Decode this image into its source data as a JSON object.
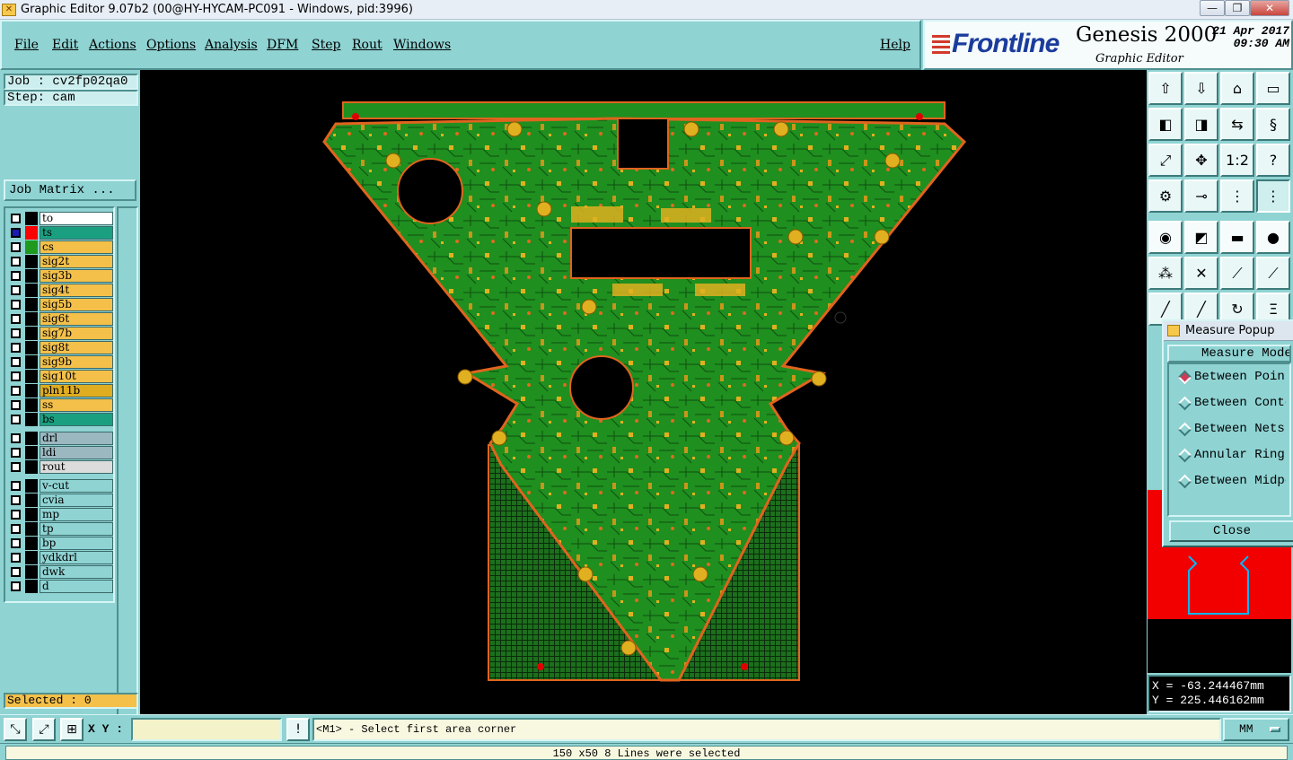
{
  "window": {
    "title": "Graphic Editor 9.07b2 (00@HY-HYCAM-PC091 - Windows, pid:3996)",
    "minimize_glyph": "—",
    "maximize_glyph": "❐",
    "close_glyph": "✕"
  },
  "menu": {
    "file": "File",
    "edit": "Edit",
    "actions": "Actions",
    "options": "Options",
    "analysis": "Analysis",
    "dfm": "DFM",
    "step": "Step",
    "rout": "Rout",
    "windows": "Windows",
    "help": "Help"
  },
  "brand": {
    "logo": "Frontline",
    "product": "Genesis 2000",
    "subtitle": "Graphic Editor",
    "date": "21 Apr 2017",
    "time": "09:30 AM"
  },
  "left": {
    "job": "Job : cv2fp02qa0",
    "step": "Step: cam",
    "job_matrix": "Job Matrix ...",
    "selected": "Selected : 0"
  },
  "layers": [
    {
      "name": "to",
      "color": "#ffffff",
      "swatch": "#000000",
      "checked": false
    },
    {
      "name": "ts",
      "color": "#1aa080",
      "swatch": "#ff0000",
      "checked": true
    },
    {
      "name": "cs",
      "color": "#f4c04a",
      "swatch": "#1f9a1f",
      "checked": false
    },
    {
      "name": "sig2t",
      "color": "#f4c04a",
      "swatch": "#000000",
      "checked": false
    },
    {
      "name": "sig3b",
      "color": "#f4c04a",
      "swatch": "#000000",
      "checked": false
    },
    {
      "name": "sig4t",
      "color": "#f4c04a",
      "swatch": "#000000",
      "checked": false
    },
    {
      "name": "sig5b",
      "color": "#f4c04a",
      "swatch": "#000000",
      "checked": false
    },
    {
      "name": "sig6t",
      "color": "#f4c04a",
      "swatch": "#000000",
      "checked": false
    },
    {
      "name": "sig7b",
      "color": "#f4c04a",
      "swatch": "#000000",
      "checked": false
    },
    {
      "name": "sig8t",
      "color": "#f4c04a",
      "swatch": "#000000",
      "checked": false
    },
    {
      "name": "sig9b",
      "color": "#f4c04a",
      "swatch": "#000000",
      "checked": false
    },
    {
      "name": "sig10t",
      "color": "#f4c04a",
      "swatch": "#000000",
      "checked": false
    },
    {
      "name": "pln11b",
      "color": "#e0ac20",
      "swatch": "#000000",
      "checked": false
    },
    {
      "name": "ss",
      "color": "#f4c04a",
      "swatch": "#000000",
      "checked": false
    },
    {
      "name": "bs",
      "color": "#1aa080",
      "swatch": "#000000",
      "checked": false
    },
    {
      "name": "drl",
      "color": "#9bb8c0",
      "swatch": "#000000",
      "checked": false
    },
    {
      "name": "ldi",
      "color": "#9bb8c0",
      "swatch": "#000000",
      "checked": false
    },
    {
      "name": "rout",
      "color": "#dcdcdc",
      "swatch": "#000000",
      "checked": false
    },
    {
      "name": "v-cut",
      "color": "#8fd3d3",
      "swatch": "#000000",
      "checked": false
    },
    {
      "name": "cvia",
      "color": "#8fd3d3",
      "swatch": "#000000",
      "checked": false
    },
    {
      "name": "mp",
      "color": "#8fd3d3",
      "swatch": "#000000",
      "checked": false
    },
    {
      "name": "tp",
      "color": "#8fd3d3",
      "swatch": "#000000",
      "checked": false
    },
    {
      "name": "bp",
      "color": "#8fd3d3",
      "swatch": "#000000",
      "checked": false
    },
    {
      "name": "ydkdrl",
      "color": "#8fd3d3",
      "swatch": "#000000",
      "checked": false
    },
    {
      "name": "dwk",
      "color": "#8fd3d3",
      "swatch": "#000000",
      "checked": false
    },
    {
      "name": "d",
      "color": "#8fd3d3",
      "swatch": "#000000",
      "checked": false
    }
  ],
  "toolbar": {
    "scale_label": "1:2",
    "help_label": "?"
  },
  "measure_popup": {
    "title": "Measure Popup",
    "mode": "Measure Mode",
    "options": [
      {
        "label": "Between Points",
        "selected": true
      },
      {
        "label": "Between Contours",
        "selected": false
      },
      {
        "label": "Between Nets",
        "selected": false
      },
      {
        "label": "Annular Ring",
        "selected": false
      },
      {
        "label": "Between Midpoints",
        "selected": false
      }
    ],
    "close": "Close"
  },
  "coords": {
    "x": "X = -63.244467mm",
    "y": "Y = 225.446162mm"
  },
  "bottom": {
    "xy_label": "X Y :",
    "xy_value": "",
    "prompt": "<M1> - Select first area corner",
    "units": "MM",
    "status": "150 x50 8 Lines were selected"
  },
  "colors": {
    "board": "#1f8f1f",
    "outline": "#e0641e",
    "pads": "#e0b020",
    "background": "#8fd3d3"
  }
}
